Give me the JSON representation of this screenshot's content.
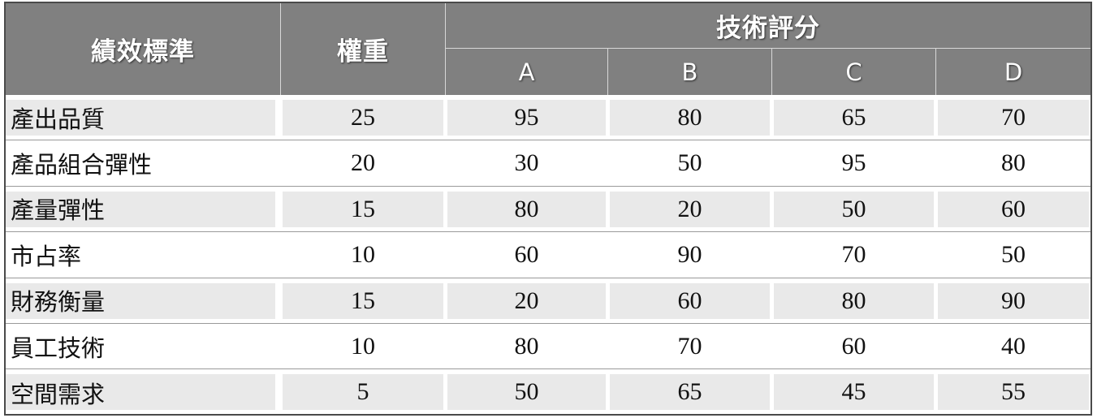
{
  "header": {
    "criteria": "績效標準",
    "weight": "權重",
    "tech_score": "技術評分",
    "techs": [
      "A",
      "B",
      "C",
      "D"
    ]
  },
  "rows": [
    {
      "label": "產出品質",
      "weight": "25",
      "scores": [
        "95",
        "80",
        "65",
        "70"
      ]
    },
    {
      "label": "產品組合彈性",
      "weight": "20",
      "scores": [
        "30",
        "50",
        "95",
        "80"
      ]
    },
    {
      "label": "產量彈性",
      "weight": "15",
      "scores": [
        "80",
        "20",
        "50",
        "60"
      ]
    },
    {
      "label": "市占率",
      "weight": "10",
      "scores": [
        "60",
        "90",
        "70",
        "50"
      ]
    },
    {
      "label": "財務衡量",
      "weight": "15",
      "scores": [
        "20",
        "60",
        "80",
        "90"
      ]
    },
    {
      "label": "員工技術",
      "weight": "10",
      "scores": [
        "80",
        "70",
        "60",
        "40"
      ]
    },
    {
      "label": "空間需求",
      "weight": "5",
      "scores": [
        "50",
        "65",
        "45",
        "55"
      ]
    }
  ],
  "colors": {
    "header_bg": "#808080",
    "cell_bg": "#e9e9e9",
    "border": "#4a4a4a"
  }
}
